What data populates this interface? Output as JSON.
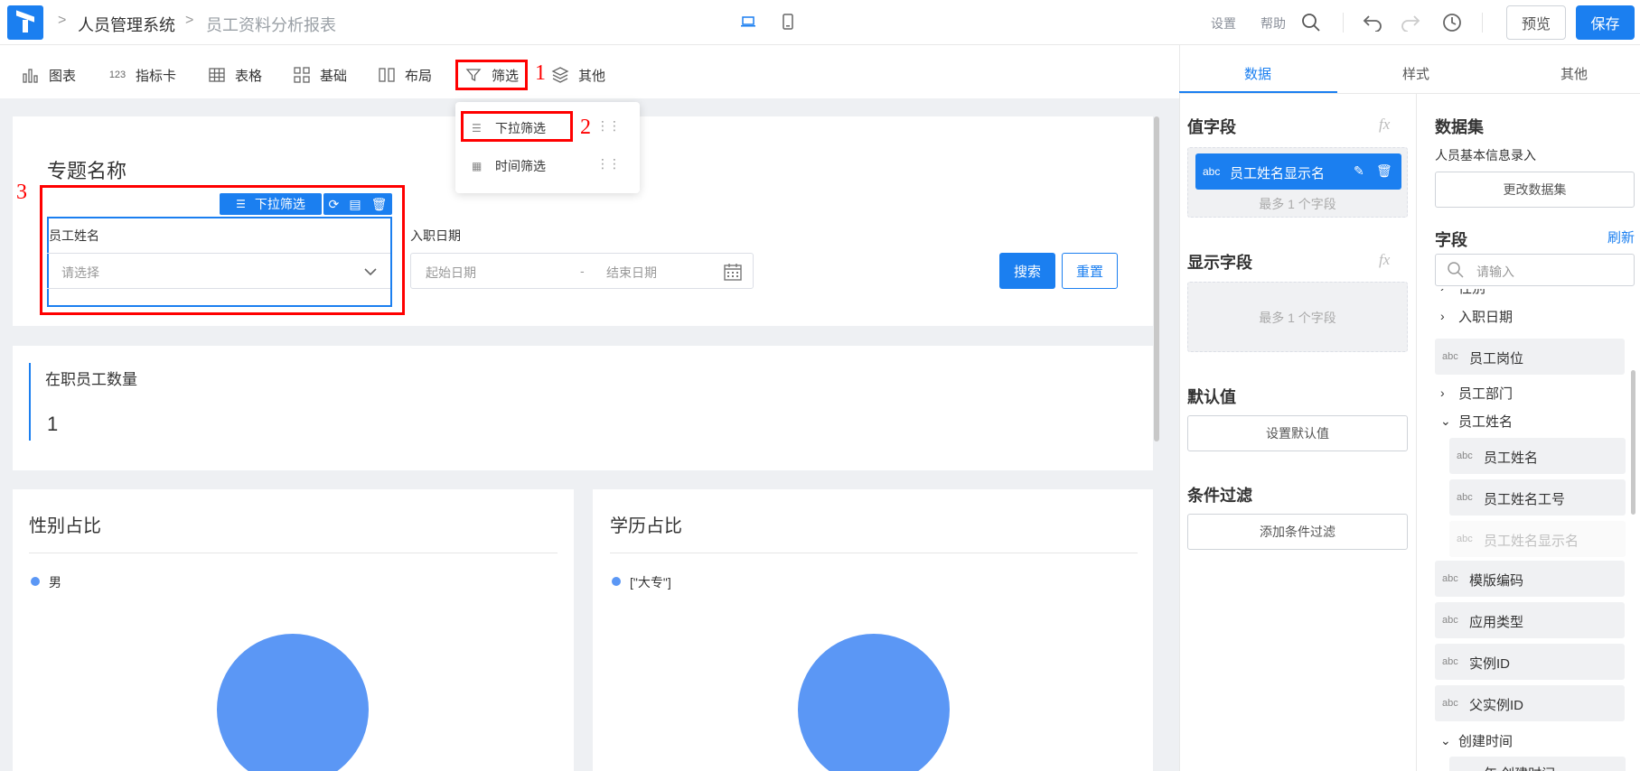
{
  "header": {
    "breadcrumb": [
      "人员管理系统",
      "员工资料分析报表"
    ],
    "links": [
      "设置",
      "帮助"
    ],
    "preview_label": "预览",
    "save_label": "保存"
  },
  "toolbar": {
    "items": [
      "图表",
      "指标卡",
      "表格",
      "基础",
      "布局",
      "筛选",
      "其他"
    ],
    "icons": [
      "bar-chart-icon",
      "number-icon",
      "table-icon",
      "grid-icon",
      "columns-icon",
      "funnel-icon",
      "layers-icon"
    ],
    "index_glyph": "123"
  },
  "annotations": [
    "1",
    "2",
    "3"
  ],
  "popover": {
    "items": [
      "下拉筛选",
      "时间筛选"
    ]
  },
  "canvas": {
    "topic_title": "专题名称",
    "filter_tag": "下拉筛选",
    "filters": {
      "name_label": "员工姓名",
      "name_placeholder": "请选择",
      "date_label": "入职日期",
      "date_start": "起始日期",
      "date_sep": "-",
      "date_end": "结束日期"
    },
    "search_label": "搜索",
    "reset_label": "重置",
    "kpi": {
      "title": "在职员工数量",
      "value": "1"
    },
    "charts": [
      {
        "title": "性别占比",
        "legend": "男"
      },
      {
        "title": "学历占比",
        "legend": "[\"大专\"]"
      }
    ]
  },
  "right_panel": {
    "tabs": [
      "数据",
      "样式",
      "其他"
    ],
    "value_field": {
      "title": "值字段",
      "chip_type": "abc",
      "chip_label": "员工姓名显示名",
      "hint": "最多 1 个字段"
    },
    "display_field": {
      "title": "显示字段",
      "hint": "最多 1 个字段"
    },
    "default_value": {
      "title": "默认值",
      "button": "设置默认值"
    },
    "condition_filter": {
      "title": "条件过滤",
      "button": "添加条件过滤"
    },
    "fx_label": "fx",
    "dataset": {
      "title": "数据集",
      "name": "人员基本信息录入",
      "change_button": "更改数据集"
    },
    "fields": {
      "title": "字段",
      "refresh": "刷新",
      "search_placeholder": "请输入",
      "partial_top": "性别",
      "nodes": [
        {
          "type": "group",
          "label": "入职日期",
          "expanded": false
        },
        {
          "type": "leaf",
          "abc": "abc",
          "label": "员工岗位"
        },
        {
          "type": "group",
          "label": "员工部门",
          "expanded": false
        },
        {
          "type": "group",
          "label": "员工姓名",
          "expanded": true
        },
        {
          "type": "child",
          "abc": "abc",
          "label": "员工姓名"
        },
        {
          "type": "child",
          "abc": "abc",
          "label": "员工姓名工号"
        },
        {
          "type": "child-disabled",
          "abc": "abc",
          "label": "员工姓名显示名"
        },
        {
          "type": "leaf",
          "abc": "abc",
          "label": "模版编码"
        },
        {
          "type": "leaf",
          "abc": "abc",
          "label": "应用类型"
        },
        {
          "type": "leaf",
          "abc": "abc",
          "label": "实例ID"
        },
        {
          "type": "leaf",
          "abc": "abc",
          "label": "父实例ID"
        },
        {
          "type": "group",
          "label": "创建时间",
          "expanded": true
        }
      ],
      "partial_bottom": "年 创建时间"
    }
  },
  "colors": {
    "primary": "#1b7ff0",
    "annotation": "#ff0000",
    "pie": "#5b97f5"
  }
}
